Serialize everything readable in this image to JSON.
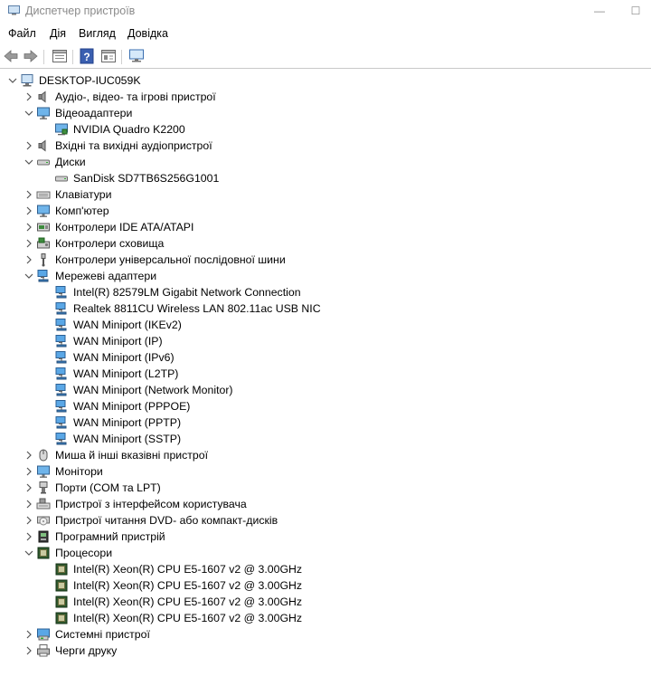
{
  "window": {
    "title": "Диспетчер пристроїв",
    "minimize": "—",
    "maximize": "☐"
  },
  "menu": [
    "Файл",
    "Дія",
    "Вигляд",
    "Довідка"
  ],
  "toolbar_icons": [
    "back-arrow-icon",
    "forward-arrow-icon",
    "properties-icon",
    "help-icon",
    "device-view-icon",
    "scan-hardware-icon"
  ],
  "tree": [
    {
      "level": 0,
      "expander": "open",
      "icon": "computer-icon",
      "label": "DESKTOP-IUC059K"
    },
    {
      "level": 1,
      "expander": "closed",
      "icon": "speaker-icon",
      "label": "Аудіо-, відео- та ігрові пристрої"
    },
    {
      "level": 1,
      "expander": "open",
      "icon": "monitor-icon",
      "label": "Відеоадаптери"
    },
    {
      "level": 2,
      "expander": "none",
      "icon": "display-adapter-icon",
      "label": "NVIDIA Quadro K2200"
    },
    {
      "level": 1,
      "expander": "closed",
      "icon": "speaker-icon",
      "label": "Вхідні та вихідні аудіопристрої"
    },
    {
      "level": 1,
      "expander": "open",
      "icon": "disk-icon",
      "label": "Диски"
    },
    {
      "level": 2,
      "expander": "none",
      "icon": "disk-icon",
      "label": "SanDisk SD7TB6S256G1001"
    },
    {
      "level": 1,
      "expander": "closed",
      "icon": "keyboard-icon",
      "label": "Клавіатури"
    },
    {
      "level": 1,
      "expander": "closed",
      "icon": "monitor-icon",
      "label": "Комп'ютер"
    },
    {
      "level": 1,
      "expander": "closed",
      "icon": "ide-controller-icon",
      "label": "Контролери IDE ATA/ATAPI"
    },
    {
      "level": 1,
      "expander": "closed",
      "icon": "storage-controller-icon",
      "label": "Контролери сховища"
    },
    {
      "level": 1,
      "expander": "closed",
      "icon": "usb-icon",
      "label": "Контролери універсальної послідовної шини"
    },
    {
      "level": 1,
      "expander": "open",
      "icon": "network-icon",
      "label": "Мережеві адаптери"
    },
    {
      "level": 2,
      "expander": "none",
      "icon": "network-icon",
      "label": "Intel(R) 82579LM Gigabit Network Connection"
    },
    {
      "level": 2,
      "expander": "none",
      "icon": "network-icon",
      "label": "Realtek 8811CU Wireless LAN 802.11ac USB NIC"
    },
    {
      "level": 2,
      "expander": "none",
      "icon": "network-icon",
      "label": "WAN Miniport (IKEv2)"
    },
    {
      "level": 2,
      "expander": "none",
      "icon": "network-icon",
      "label": "WAN Miniport (IP)"
    },
    {
      "level": 2,
      "expander": "none",
      "icon": "network-icon",
      "label": "WAN Miniport (IPv6)"
    },
    {
      "level": 2,
      "expander": "none",
      "icon": "network-icon",
      "label": "WAN Miniport (L2TP)"
    },
    {
      "level": 2,
      "expander": "none",
      "icon": "network-icon",
      "label": "WAN Miniport (Network Monitor)"
    },
    {
      "level": 2,
      "expander": "none",
      "icon": "network-icon",
      "label": "WAN Miniport (PPPOE)"
    },
    {
      "level": 2,
      "expander": "none",
      "icon": "network-icon",
      "label": "WAN Miniport (PPTP)"
    },
    {
      "level": 2,
      "expander": "none",
      "icon": "network-icon",
      "label": "WAN Miniport (SSTP)"
    },
    {
      "level": 1,
      "expander": "closed",
      "icon": "mouse-icon",
      "label": "Миша й інші вказівні пристрої"
    },
    {
      "level": 1,
      "expander": "closed",
      "icon": "monitor-icon",
      "label": "Монітори"
    },
    {
      "level": 1,
      "expander": "closed",
      "icon": "port-icon",
      "label": "Порти (COM та LPT)"
    },
    {
      "level": 1,
      "expander": "closed",
      "icon": "hid-icon",
      "label": "Пристрої з інтерфейсом користувача"
    },
    {
      "level": 1,
      "expander": "closed",
      "icon": "dvd-icon",
      "label": "Пристрої читання DVD- або компакт-дисків"
    },
    {
      "level": 1,
      "expander": "closed",
      "icon": "software-device-icon",
      "label": "Програмний пристрій"
    },
    {
      "level": 1,
      "expander": "open",
      "icon": "processor-icon",
      "label": "Процесори"
    },
    {
      "level": 2,
      "expander": "none",
      "icon": "processor-icon",
      "label": "Intel(R) Xeon(R) CPU E5-1607 v2 @ 3.00GHz"
    },
    {
      "level": 2,
      "expander": "none",
      "icon": "processor-icon",
      "label": "Intel(R) Xeon(R) CPU E5-1607 v2 @ 3.00GHz"
    },
    {
      "level": 2,
      "expander": "none",
      "icon": "processor-icon",
      "label": "Intel(R) Xeon(R) CPU E5-1607 v2 @ 3.00GHz"
    },
    {
      "level": 2,
      "expander": "none",
      "icon": "processor-icon",
      "label": "Intel(R) Xeon(R) CPU E5-1607 v2 @ 3.00GHz"
    },
    {
      "level": 1,
      "expander": "closed",
      "icon": "system-device-icon",
      "label": "Системні пристрої"
    },
    {
      "level": 1,
      "expander": "closed",
      "icon": "printer-icon",
      "label": "Черги друку"
    }
  ]
}
